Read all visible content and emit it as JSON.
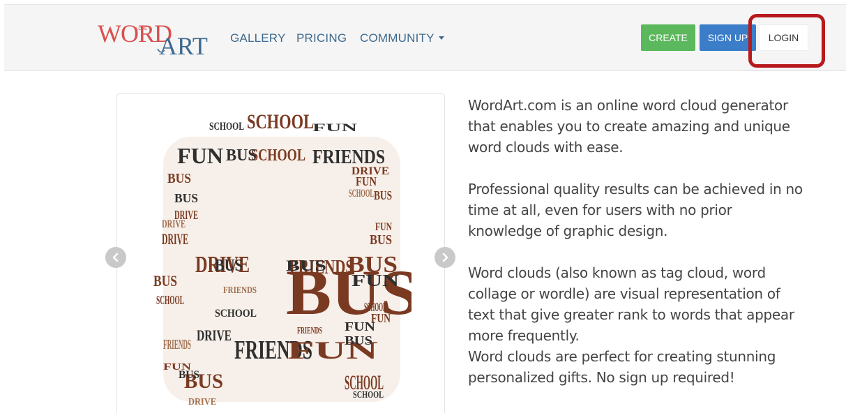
{
  "logo": {
    "part1": "WORD",
    "part2": "ART",
    "tiny_word": "LOVE"
  },
  "nav": {
    "gallery": "GALLERY",
    "pricing": "PRICING",
    "community": "COMMUNITY"
  },
  "buttons": {
    "create": "CREATE",
    "signup": "SIGN UP",
    "login": "LOGIN"
  },
  "colors": {
    "create": "#5cb85c",
    "signup": "#3b7dc8",
    "nav_link": "#3f6a8f",
    "highlight": "#b8191c",
    "logo_red": "#d9504f",
    "logo_blue": "#3f6a8f"
  },
  "wordcloud": {
    "words": [
      "BUS",
      "SCHOOL",
      "FUN",
      "DRIVE",
      "FRIENDS",
      "BUS",
      "SCHOOL",
      "FRIENDS",
      "FUN",
      "BUS",
      "DRIVE",
      "FRIENDS",
      "FUN",
      "BUS",
      "SCHOOL",
      "BUS",
      "FUN",
      "DRIVE",
      "BUS",
      "BUS",
      "SCHOOL",
      "FUN",
      "SCHOOL",
      "FUN",
      "BUS",
      "DRIVE",
      "DRIVE",
      "SCHOOL",
      "FRIENDS",
      "FUN",
      "BUS",
      "SCHOOL",
      "FRIENDS",
      "BUS",
      "FUN",
      "SCHOOL",
      "BUS",
      "DRIVE",
      "FUN",
      "BUS",
      "SCHOOL",
      "DRIVE",
      "BUS",
      "FRIENDS"
    ]
  },
  "carousel": {
    "prev_icon": "chevron-left-icon",
    "next_icon": "chevron-right-icon"
  },
  "description": {
    "p1": "WordArt.com is an online word cloud generator that enables you to create amazing and unique word clouds with ease.",
    "p2": "Professional quality results can be achieved in no time at all, even for users with no prior knowledge of graphic design.",
    "p3": "Word clouds (also known as tag cloud, word collage or wordle) are visual representation of text that give greater rank to words that appear more frequently.",
    "p4": "Word clouds are perfect for creating stunning personalized gifts. No sign up required!"
  }
}
